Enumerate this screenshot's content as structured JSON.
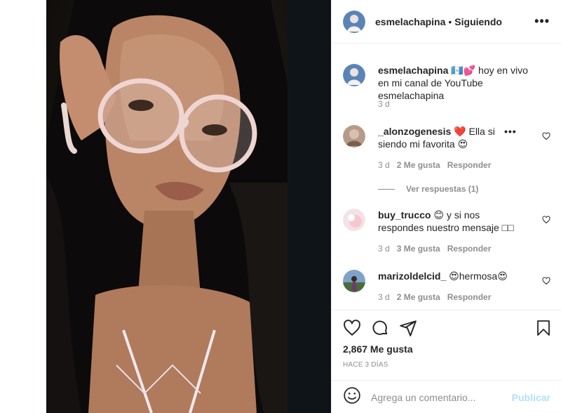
{
  "post": {
    "username": "esmelachapina",
    "separator": "•",
    "following_label": "Siguiendo",
    "more_label": "•••"
  },
  "caption": {
    "username": "esmelachapina",
    "flag": "🇬🇹",
    "emoji": "💕",
    "text": " hoy en vivo en mi canal de YouTube esmelachapina",
    "time": "3 d"
  },
  "comments": [
    {
      "username": "_alonzogenesis",
      "text_a": "❤️ Ella si",
      "text_b": "siendo mi favorita 😍",
      "overlay_more": "•••",
      "time": "3 d",
      "likes": "2 Me gusta",
      "reply": "Responder"
    },
    {
      "username": "buy_trucco",
      "text_a": "😊 y si nos",
      "text_b": "respondes nuestro mensaje □□",
      "time": "3 d",
      "likes": "3 Me gusta",
      "reply": "Responder"
    },
    {
      "username": "marizoldelcid_",
      "text_a": "😍hermosa😍",
      "time": "3 d",
      "likes": "2 Me gusta",
      "reply": "Responder"
    }
  ],
  "view_replies": "Ver respuestas (1)",
  "likes_count": "2,867 Me gusta",
  "posted_ago": "HACE 3 DÍAS",
  "comment_input": {
    "placeholder": "Agrega un comentario...",
    "post_label": "Publicar"
  },
  "icons": {
    "like": "heart-icon",
    "comment": "comment-icon",
    "share": "share-icon",
    "save": "bookmark-icon",
    "emoji": "emoji-icon"
  },
  "colors": {
    "text": "#262626",
    "muted": "#8e8e8e",
    "post_disabled": "#b2dffc",
    "heart_red": "#ed4956"
  }
}
